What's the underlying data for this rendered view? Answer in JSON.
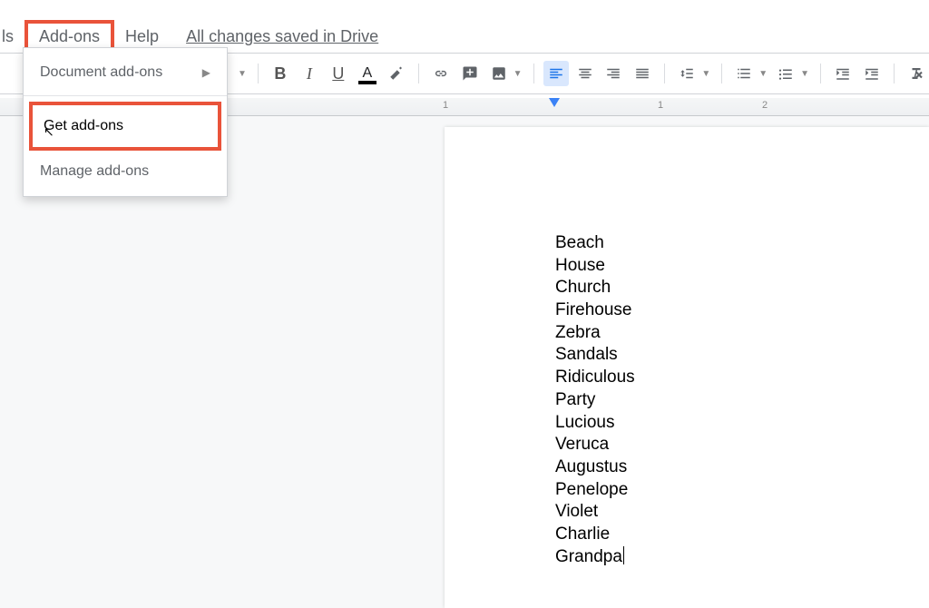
{
  "menubar": {
    "partial_tools": "ls",
    "addons_label": "Add-ons",
    "help_label": "Help",
    "saved_status": "All changes saved in Drive"
  },
  "dropdown": {
    "document_addons": "Document add-ons",
    "get_addons": "Get add-ons",
    "manage_addons": "Manage add-ons"
  },
  "toolbar": {
    "bold": "B",
    "italic": "I",
    "underline": "U",
    "textcolor_letter": "A"
  },
  "ruler": {
    "marks": [
      "1",
      "1",
      "2"
    ]
  },
  "document": {
    "lines": [
      "Beach",
      "House",
      "Church",
      "Firehouse",
      "Zebra",
      "Sandals",
      "Ridiculous",
      "Party",
      "Lucious",
      "Veruca",
      "Augustus",
      "Penelope",
      "Violet",
      "Charlie",
      "Grandpa"
    ]
  },
  "colors": {
    "highlight_border": "#e9533a",
    "active_tool": "#1a73e8"
  }
}
